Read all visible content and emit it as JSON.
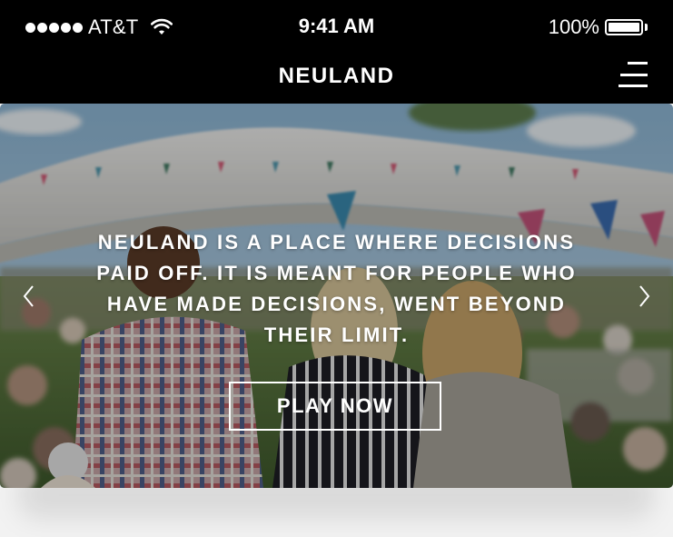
{
  "status_bar": {
    "carrier": "AT&T",
    "time": "9:41 AM",
    "battery_percent": "100%",
    "signal_icon": "signal-dots-icon",
    "wifi_icon": "wifi-icon",
    "battery_icon": "battery-icon"
  },
  "nav": {
    "brand": "NEULAND",
    "menu_icon": "hamburger-menu-icon"
  },
  "hero": {
    "headline": "NEULAND IS A PLACE WHERE DECISIONS PAID OFF. IT IS MEANT FOR PEOPLE WHO HAVE MADE DECISIONS, WENT BEYOND THEIR LIMIT.",
    "cta_label": "PLAY NOW",
    "prev_icon": "chevron-left-icon",
    "next_icon": "chevron-right-icon"
  },
  "colors": {
    "bar_background": "#000000",
    "text_light": "#ffffff",
    "page_background": "#f2f2f2"
  }
}
